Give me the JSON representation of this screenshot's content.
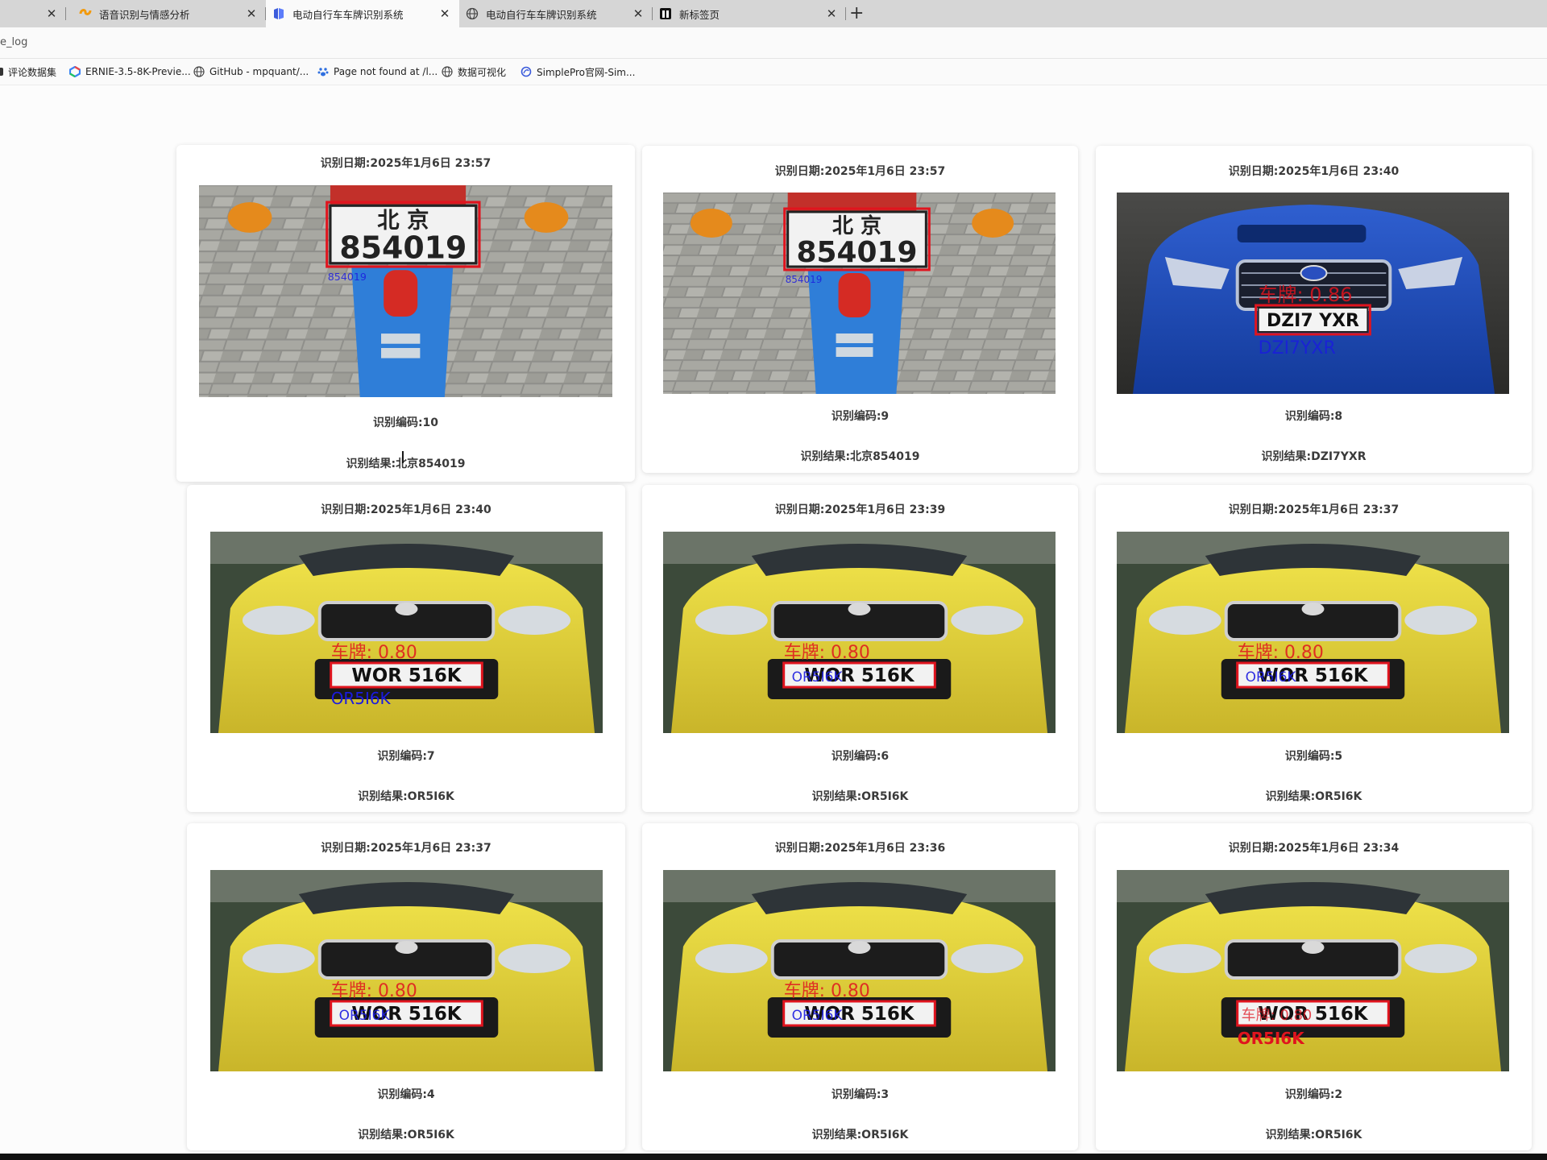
{
  "browser": {
    "tabs": [
      {
        "title": "语音识别与情感分析",
        "active": false
      },
      {
        "title": "电动自行车车牌识别系统",
        "active": true
      },
      {
        "title": "电动自行车车牌识别系统",
        "active": false
      },
      {
        "title": "新标签页",
        "active": false
      }
    ],
    "url": "e_log",
    "bookmarks": [
      {
        "label": "评论数据集"
      },
      {
        "label": "ERNIE-3.5-8K-Previe..."
      },
      {
        "label": "GitHub - mpquant/..."
      },
      {
        "label": "Page not found at /l..."
      },
      {
        "label": "数据可视化"
      },
      {
        "label": "SimplePro官网-Sim..."
      }
    ]
  },
  "records": [
    {
      "date": "识别日期:2025年1月6日 23:57",
      "code": "识别编码:10",
      "result": "识别结果:北京854019"
    },
    {
      "date": "识别日期:2025年1月6日 23:57",
      "code": "识别编码:9",
      "result": "识别结果:北京854019"
    },
    {
      "date": "识别日期:2025年1月6日 23:40",
      "code": "识别编码:8",
      "result": "识别结果:DZI7YXR"
    },
    {
      "date": "识别日期:2025年1月6日 23:40",
      "code": "识别编码:7",
      "result": "识别结果:OR5I6K"
    },
    {
      "date": "识别日期:2025年1月6日 23:39",
      "code": "识别编码:6",
      "result": "识别结果:OR5I6K"
    },
    {
      "date": "识别日期:2025年1月6日 23:37",
      "code": "识别编码:5",
      "result": "识别结果:OR5I6K"
    },
    {
      "date": "识别日期:2025年1月6日 23:37",
      "code": "识别编码:4",
      "result": "识别结果:OR5I6K"
    },
    {
      "date": "识别日期:2025年1月6日 23:36",
      "code": "识别编码:3",
      "result": "识别结果:OR5I6K"
    },
    {
      "date": "识别日期:2025年1月6日 23:34",
      "code": "识别编码:2",
      "result": "识别结果:OR5I6K"
    }
  ],
  "image_overlays": {
    "moto_plate_top": "北 京",
    "moto_plate_bottom": "854019",
    "uk_plate_blue": "DZI7 YXR",
    "uk_plate_blue_conf": "车牌: 0.86",
    "uk_plate_blue_read": "DZI7YXR",
    "uk_plate_yellow": "WOR 516K",
    "uk_plate_yellow_conf": "车牌: 0.80",
    "uk_plate_yellow_read": "OR5I6K"
  },
  "colors": {
    "detect_box": "#e0141e",
    "detect_text": "#1a1ae0"
  }
}
